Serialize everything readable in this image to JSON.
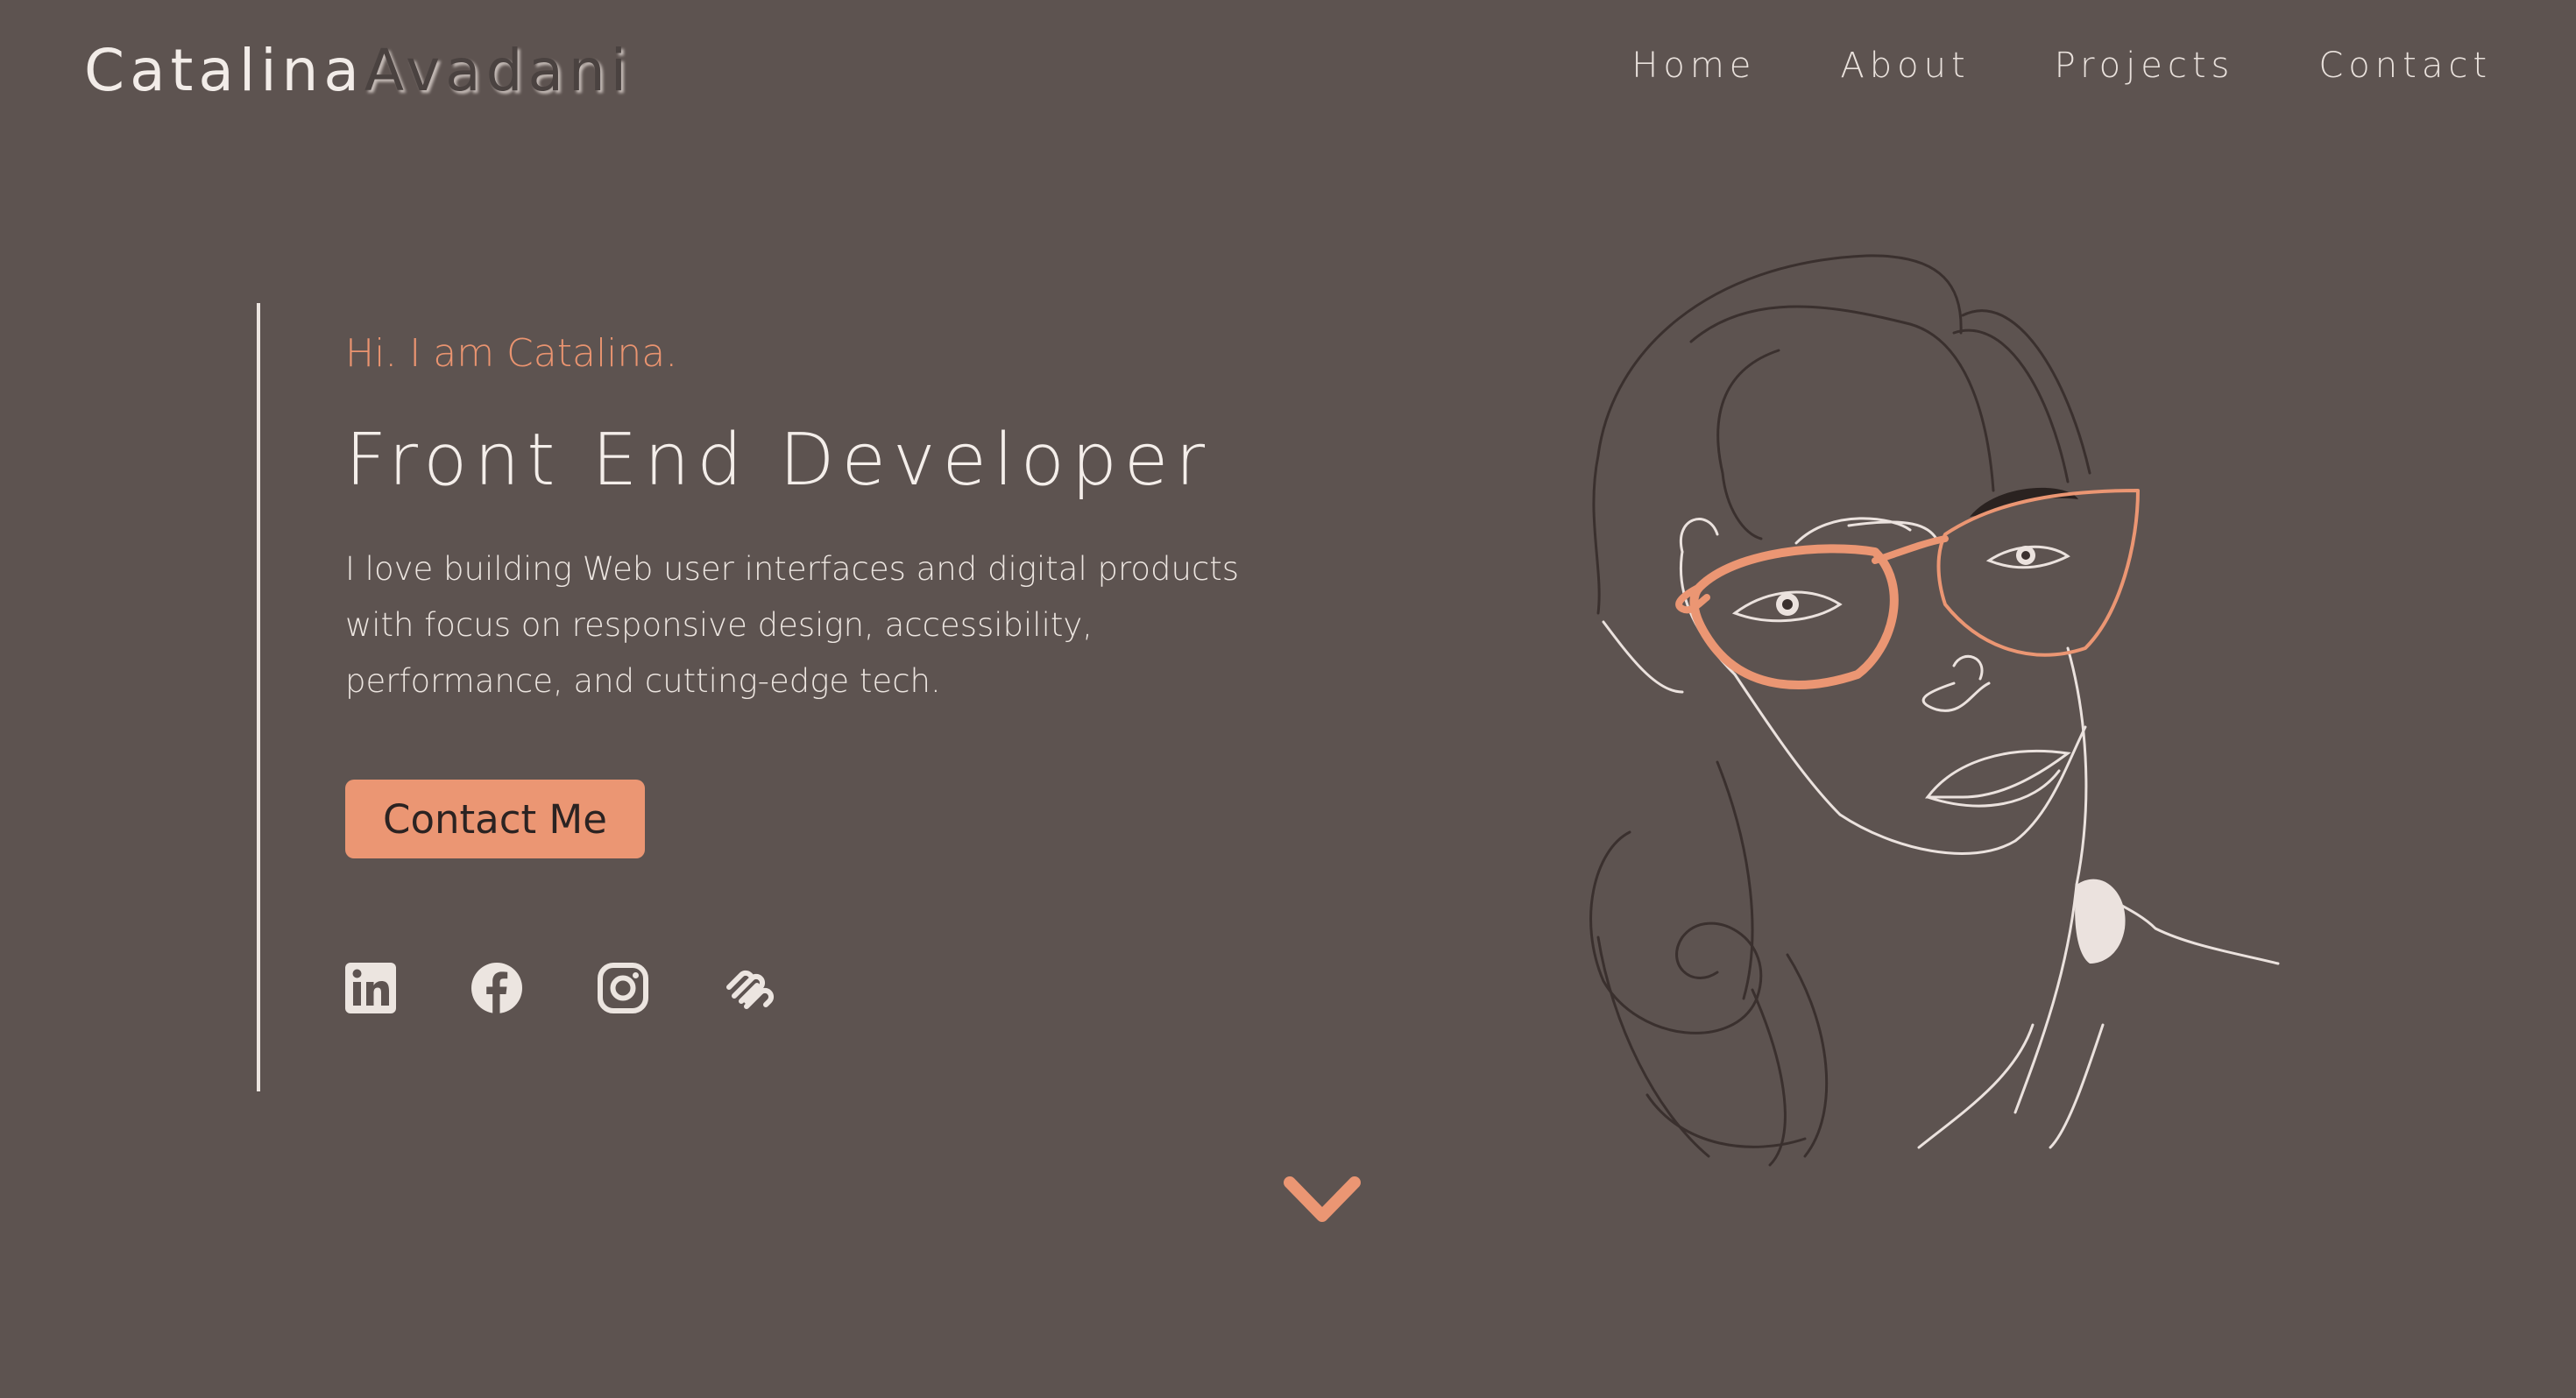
{
  "header": {
    "logo_first": "Catalina",
    "logo_last": "Avadani",
    "nav": [
      {
        "label": "Home"
      },
      {
        "label": "About"
      },
      {
        "label": "Projects"
      },
      {
        "label": "Contact"
      }
    ]
  },
  "hero": {
    "greeting": "Hi. I am Catalina.",
    "title": "Front End Developer",
    "description": "I love building Web user interfaces and digital products with focus on responsive design, accessibility, performance, and cutting-edge tech.",
    "cta_label": "Contact Me",
    "social": [
      {
        "icon": "linkedin-icon"
      },
      {
        "icon": "facebook-icon"
      },
      {
        "icon": "instagram-icon"
      },
      {
        "icon": "squarespace-icon"
      }
    ],
    "scroll_icon": "chevron-down-icon"
  },
  "colors": {
    "background": "#5d5350",
    "accent": "#eb9673",
    "text": "#f2ece8",
    "line_dark": "#3a302e"
  }
}
